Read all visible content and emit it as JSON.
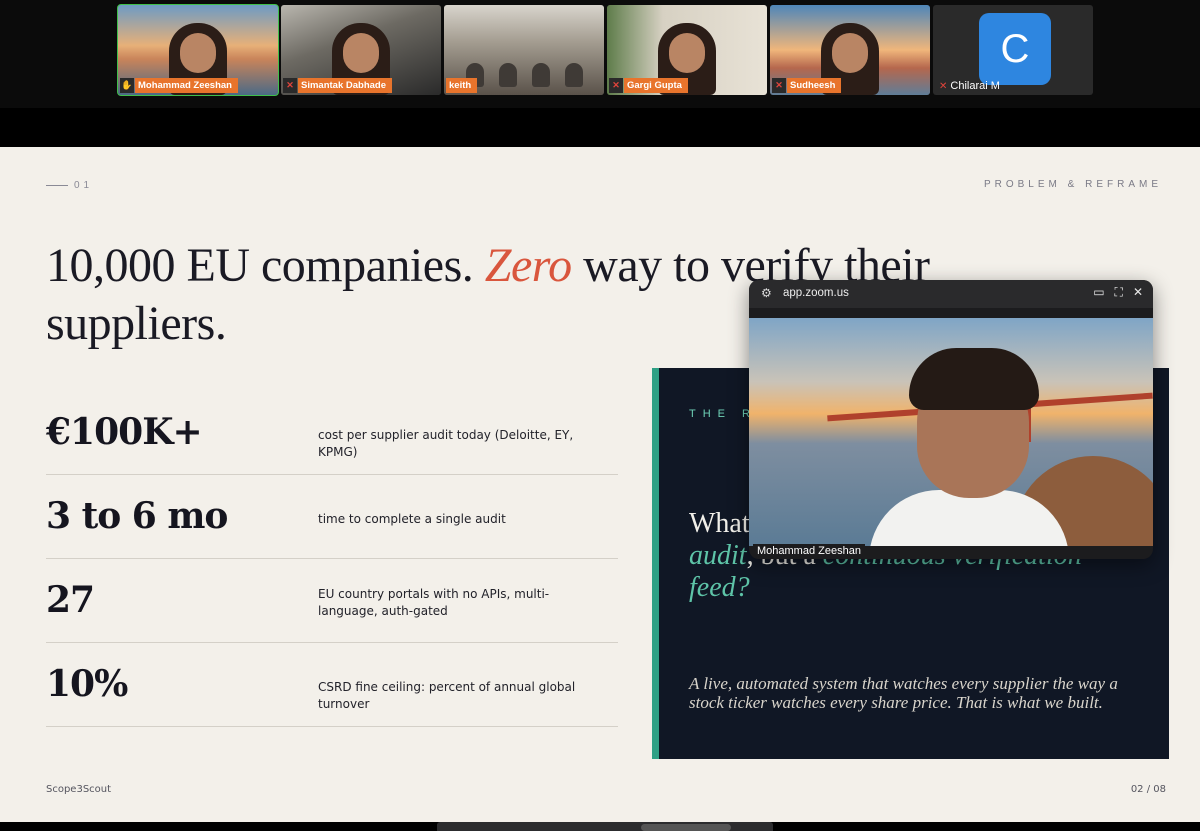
{
  "participants": [
    {
      "name": "Mohammad Zeeshan",
      "scene": "sunset"
    },
    {
      "name": "Simantak Dabhade",
      "scene": "office"
    },
    {
      "name": "keith",
      "scene": "conf"
    },
    {
      "name": "Gargi Gupta",
      "scene": "home"
    },
    {
      "name": "Sudheesh",
      "scene": "sunset2"
    },
    {
      "name": "Chilarai M",
      "initial": "C"
    }
  ],
  "slide": {
    "number": "01",
    "section": "PROBLEM & REFRAME",
    "headline_pre": "10,000 EU companies. ",
    "headline_em": "Zero",
    "headline_post": " way to verify their suppliers.",
    "stats": [
      {
        "value": "€100K+",
        "desc": "cost per supplier audit today (Deloitte, EY, KPMG)"
      },
      {
        "value": "3 to 6 mo",
        "desc": "time to complete a single audit"
      },
      {
        "value": "27",
        "desc": "EU country portals with no APIs, multi-language, auth-gated"
      },
      {
        "value": "10%",
        "desc": "CSRD fine ceiling: percent of annual global turnover"
      }
    ],
    "panel": {
      "kicker": "THE R",
      "question_pre": "What",
      "question_teal_1": "audit",
      "question_mid": ", but a ",
      "question_teal_2": "continuous verification feed?",
      "body": "A live, automated system that watches every supplier the way a stock ticker watches every share price. That is what we built."
    },
    "footer_brand": "Scope3Scout",
    "page_counter": "02 / 08"
  },
  "pip": {
    "url": "app.zoom.us",
    "speaker": "Mohammad Zeeshan"
  },
  "colors": {
    "accent_red": "#d9563d",
    "teal": "#5ec4a8",
    "panel_bg": "#101725",
    "name_tag": "#e8742c",
    "active_speaker": "#3fbf4a"
  }
}
